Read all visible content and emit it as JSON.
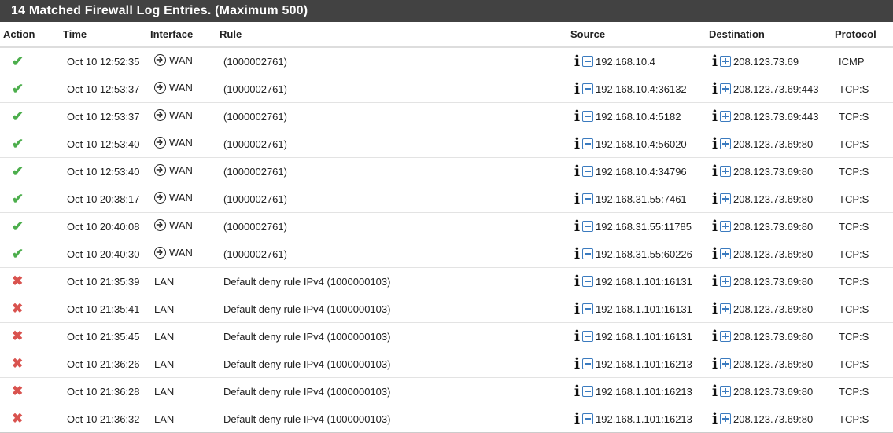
{
  "panel": {
    "title": "14 Matched Firewall Log Entries. (Maximum 500)"
  },
  "columns": {
    "action": "Action",
    "time": "Time",
    "interface": "Interface",
    "rule": "Rule",
    "source": "Source",
    "destination": "Destination",
    "protocol": "Protocol"
  },
  "icons": {
    "pass": "check-icon",
    "block": "x-icon",
    "inbound": "arrow-circle-right-icon",
    "info": "info-icon",
    "src_action": "minus-square-icon",
    "dst_action": "plus-square-icon"
  },
  "colors": {
    "header_bg": "#424242",
    "pass": "#4cae4c",
    "block": "#d9534f",
    "pm_blue": "#3b7bbf"
  },
  "rows": [
    {
      "action": "pass",
      "time": "Oct 10 12:52:35",
      "interface": "WAN",
      "rule": "(1000002761)",
      "source": "192.168.10.4",
      "destination": "208.123.73.69",
      "protocol": "ICMP"
    },
    {
      "action": "pass",
      "time": "Oct 10 12:53:37",
      "interface": "WAN",
      "rule": "(1000002761)",
      "source": "192.168.10.4:36132",
      "destination": "208.123.73.69:443",
      "protocol": "TCP:S"
    },
    {
      "action": "pass",
      "time": "Oct 10 12:53:37",
      "interface": "WAN",
      "rule": "(1000002761)",
      "source": "192.168.10.4:5182",
      "destination": "208.123.73.69:443",
      "protocol": "TCP:S"
    },
    {
      "action": "pass",
      "time": "Oct 10 12:53:40",
      "interface": "WAN",
      "rule": "(1000002761)",
      "source": "192.168.10.4:56020",
      "destination": "208.123.73.69:80",
      "protocol": "TCP:S"
    },
    {
      "action": "pass",
      "time": "Oct 10 12:53:40",
      "interface": "WAN",
      "rule": "(1000002761)",
      "source": "192.168.10.4:34796",
      "destination": "208.123.73.69:80",
      "protocol": "TCP:S"
    },
    {
      "action": "pass",
      "time": "Oct 10 20:38:17",
      "interface": "WAN",
      "rule": "(1000002761)",
      "source": "192.168.31.55:7461",
      "destination": "208.123.73.69:80",
      "protocol": "TCP:S"
    },
    {
      "action": "pass",
      "time": "Oct 10 20:40:08",
      "interface": "WAN",
      "rule": "(1000002761)",
      "source": "192.168.31.55:11785",
      "destination": "208.123.73.69:80",
      "protocol": "TCP:S"
    },
    {
      "action": "pass",
      "time": "Oct 10 20:40:30",
      "interface": "WAN",
      "rule": "(1000002761)",
      "source": "192.168.31.55:60226",
      "destination": "208.123.73.69:80",
      "protocol": "TCP:S"
    },
    {
      "action": "block",
      "time": "Oct 10 21:35:39",
      "interface": "LAN",
      "rule": "Default deny rule IPv4 (1000000103)",
      "source": "192.168.1.101:16131",
      "destination": "208.123.73.69:80",
      "protocol": "TCP:S"
    },
    {
      "action": "block",
      "time": "Oct 10 21:35:41",
      "interface": "LAN",
      "rule": "Default deny rule IPv4 (1000000103)",
      "source": "192.168.1.101:16131",
      "destination": "208.123.73.69:80",
      "protocol": "TCP:S"
    },
    {
      "action": "block",
      "time": "Oct 10 21:35:45",
      "interface": "LAN",
      "rule": "Default deny rule IPv4 (1000000103)",
      "source": "192.168.1.101:16131",
      "destination": "208.123.73.69:80",
      "protocol": "TCP:S"
    },
    {
      "action": "block",
      "time": "Oct 10 21:36:26",
      "interface": "LAN",
      "rule": "Default deny rule IPv4 (1000000103)",
      "source": "192.168.1.101:16213",
      "destination": "208.123.73.69:80",
      "protocol": "TCP:S"
    },
    {
      "action": "block",
      "time": "Oct 10 21:36:28",
      "interface": "LAN",
      "rule": "Default deny rule IPv4 (1000000103)",
      "source": "192.168.1.101:16213",
      "destination": "208.123.73.69:80",
      "protocol": "TCP:S"
    },
    {
      "action": "block",
      "time": "Oct 10 21:36:32",
      "interface": "LAN",
      "rule": "Default deny rule IPv4 (1000000103)",
      "source": "192.168.1.101:16213",
      "destination": "208.123.73.69:80",
      "protocol": "TCP:S"
    }
  ]
}
